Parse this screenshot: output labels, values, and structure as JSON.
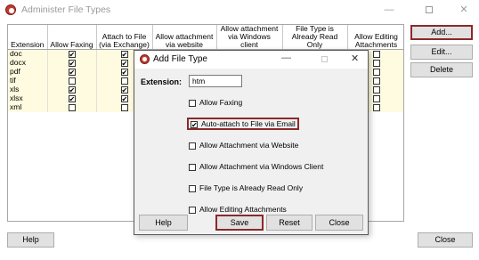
{
  "window": {
    "title": "Administer File Types",
    "min_glyph": "—",
    "close_glyph": "✕"
  },
  "grid": {
    "columns": [
      "Extension",
      "Allow Faxing",
      "Attach to File (via Exchange)",
      "Allow attachment via website",
      "Allow attachment via Windows client",
      "File Type is Already Read Only",
      "Allow Editing Attachments"
    ],
    "rows": [
      {
        "ext": "doc",
        "checks": [
          "✔",
          "✔",
          "✔",
          "",
          "",
          ""
        ]
      },
      {
        "ext": "docx",
        "checks": [
          "✔",
          "✔",
          "",
          "",
          "",
          ""
        ]
      },
      {
        "ext": "pdf",
        "checks": [
          "✔",
          "✔",
          "",
          "",
          "",
          ""
        ]
      },
      {
        "ext": "tif",
        "checks": [
          "",
          "",
          "",
          "",
          "",
          ""
        ]
      },
      {
        "ext": "xls",
        "checks": [
          "✔",
          "✔",
          "",
          "",
          "",
          ""
        ]
      },
      {
        "ext": "xlsx",
        "checks": [
          "✔",
          "✔",
          "",
          "",
          "",
          ""
        ]
      },
      {
        "ext": "xml",
        "checks": [
          "",
          "",
          "",
          "",
          "",
          ""
        ]
      }
    ]
  },
  "side_buttons": {
    "add": "Add...",
    "edit": "Edit...",
    "delete": "Delete"
  },
  "footer": {
    "help": "Help",
    "close": "Close"
  },
  "dialog": {
    "title": "Add File Type",
    "min_glyph": "—",
    "close_glyph": "✕",
    "extension_label": "Extension:",
    "extension_value": "htm",
    "options": [
      {
        "label": "Allow Faxing",
        "checked": ""
      },
      {
        "label": "Auto-attach to File via Email",
        "checked": "✔"
      },
      {
        "label": "Allow Attachment via Website",
        "checked": ""
      },
      {
        "label": "Allow Attachment via Windows Client",
        "checked": ""
      },
      {
        "label": "File Type is Already Read Only",
        "checked": ""
      },
      {
        "label": "Allow Editing Attachments",
        "checked": ""
      }
    ],
    "buttons": {
      "help": "Help",
      "save": "Save",
      "reset": "Reset",
      "close": "Close"
    }
  },
  "colors": {
    "highlight_border": "#8b2a2a",
    "row_background": "#fffbe0",
    "app_icon": "#c23a30"
  }
}
